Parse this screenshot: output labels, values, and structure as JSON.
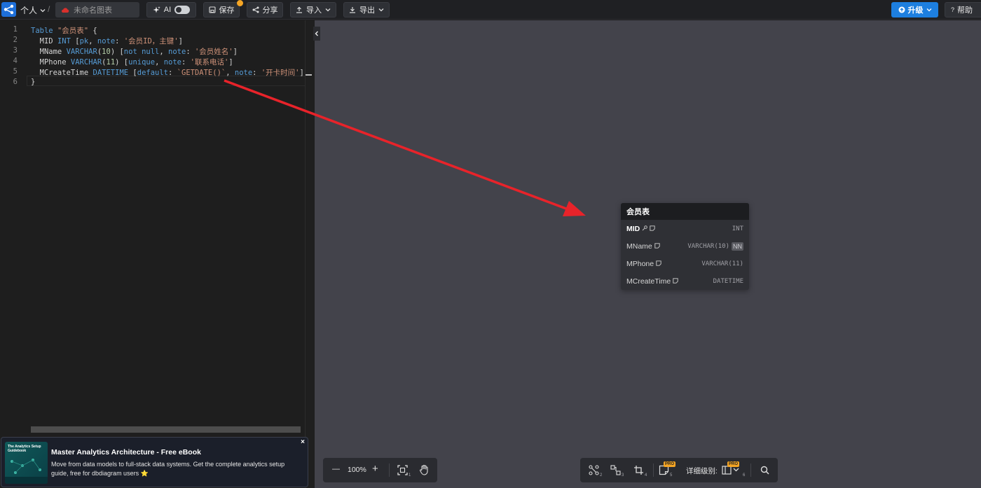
{
  "toolbar": {
    "workspace_label": "个人",
    "separator": "/",
    "diagram_name_placeholder": "未命名图表",
    "ai_label": "AI",
    "save_label": "保存",
    "share_label": "分享",
    "import_label": "导入",
    "export_label": "导出",
    "upgrade_label": "升级",
    "help_label": "帮助"
  },
  "editor": {
    "line_numbers": [
      "1",
      "2",
      "3",
      "4",
      "5",
      "6"
    ],
    "lines": [
      [
        {
          "t": "Table ",
          "c": "kw"
        },
        {
          "t": "\"会员表\"",
          "c": "str"
        },
        {
          "t": " {",
          "c": ""
        }
      ],
      [
        {
          "t": "  MID ",
          "c": ""
        },
        {
          "t": "INT",
          "c": "kw"
        },
        {
          "t": " [",
          "c": ""
        },
        {
          "t": "pk",
          "c": "kw"
        },
        {
          "t": ", ",
          "c": ""
        },
        {
          "t": "note",
          "c": "kw"
        },
        {
          "t": ": ",
          "c": ""
        },
        {
          "t": "'会员ID，主键'",
          "c": "str"
        },
        {
          "t": "]",
          "c": ""
        }
      ],
      [
        {
          "t": "  MName ",
          "c": ""
        },
        {
          "t": "VARCHAR",
          "c": "kw"
        },
        {
          "t": "(",
          "c": ""
        },
        {
          "t": "10",
          "c": "num"
        },
        {
          "t": ") [",
          "c": ""
        },
        {
          "t": "not null",
          "c": "kw"
        },
        {
          "t": ", ",
          "c": ""
        },
        {
          "t": "note",
          "c": "kw"
        },
        {
          "t": ": ",
          "c": ""
        },
        {
          "t": "'会员姓名'",
          "c": "str"
        },
        {
          "t": "]",
          "c": ""
        }
      ],
      [
        {
          "t": "  MPhone ",
          "c": ""
        },
        {
          "t": "VARCHAR",
          "c": "kw"
        },
        {
          "t": "(",
          "c": ""
        },
        {
          "t": "11",
          "c": "num"
        },
        {
          "t": ") [",
          "c": ""
        },
        {
          "t": "unique",
          "c": "kw"
        },
        {
          "t": ", ",
          "c": ""
        },
        {
          "t": "note",
          "c": "kw"
        },
        {
          "t": ": ",
          "c": ""
        },
        {
          "t": "'联系电话'",
          "c": "str"
        },
        {
          "t": "]",
          "c": ""
        }
      ],
      [
        {
          "t": "  MCreateTime ",
          "c": ""
        },
        {
          "t": "DATETIME",
          "c": "kw"
        },
        {
          "t": " [",
          "c": ""
        },
        {
          "t": "default",
          "c": "kw"
        },
        {
          "t": ": ",
          "c": ""
        },
        {
          "t": "`GETDATE()`",
          "c": "str"
        },
        {
          "t": ", ",
          "c": ""
        },
        {
          "t": "note",
          "c": "kw"
        },
        {
          "t": ": ",
          "c": ""
        },
        {
          "t": "'开卡时间'",
          "c": "str"
        },
        {
          "t": "]",
          "c": ""
        }
      ],
      [
        {
          "t": "}",
          "c": ""
        }
      ]
    ]
  },
  "table_card": {
    "title": "会员表",
    "fields": [
      {
        "name": "MID",
        "type": "INT",
        "bold": true,
        "pk": true,
        "note": true,
        "nn": false
      },
      {
        "name": "MName",
        "type": "VARCHAR(10)",
        "bold": false,
        "pk": false,
        "note": true,
        "nn": true
      },
      {
        "name": "MPhone",
        "type": "VARCHAR(11)",
        "bold": false,
        "pk": false,
        "note": true,
        "nn": false
      },
      {
        "name": "MCreateTime",
        "type": "DATETIME",
        "bold": false,
        "pk": false,
        "note": true,
        "nn": false
      }
    ],
    "nn_label": "NN"
  },
  "zoom": {
    "minus": "—",
    "level": "100%",
    "plus": "+",
    "fit_shortcut": "1"
  },
  "tools": {
    "shortcuts": [
      "2",
      "3",
      "4",
      "5",
      "6"
    ],
    "pro_label": "PRO",
    "detail_level_label": "详细级别:"
  },
  "ad": {
    "thumb_text": "The Analytics Setup Guidebook",
    "title": "Master Analytics Architecture - Free eBook",
    "body": "Move from data models to full-stack data systems. Get the complete analytics setup guide, free for dbdiagram users ⭐",
    "close": "×"
  },
  "colors": {
    "canvas": "#43434b",
    "accent": "#1d7fe0",
    "arrow": "#e8232a",
    "pro_badge": "#f5a524"
  }
}
